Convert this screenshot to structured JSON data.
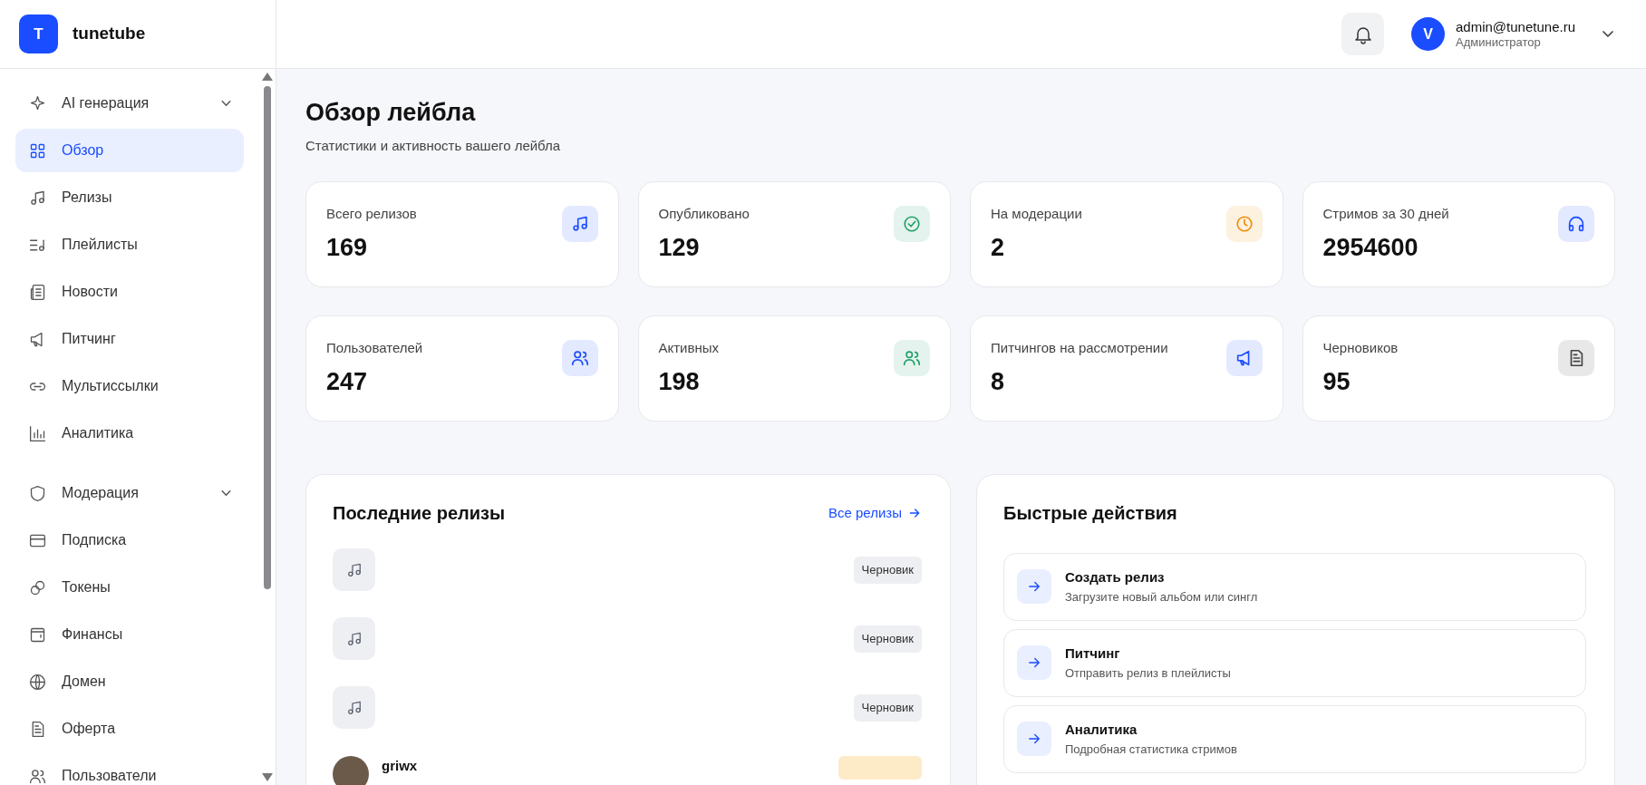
{
  "brand": {
    "logo_letter": "T",
    "name": "tunetube"
  },
  "user": {
    "avatar_letter": "V",
    "email": "admin@tunetune.ru",
    "role": "Администратор"
  },
  "sidebar": {
    "items": [
      {
        "label": "AI генерация",
        "kind": "group",
        "selected": false
      },
      {
        "label": "Обзор",
        "kind": "link",
        "selected": true
      },
      {
        "label": "Релизы",
        "kind": "link",
        "selected": false
      },
      {
        "label": "Плейлисты",
        "kind": "link",
        "selected": false
      },
      {
        "label": "Новости",
        "kind": "link",
        "selected": false
      },
      {
        "label": "Питчинг",
        "kind": "link",
        "selected": false
      },
      {
        "label": "Мультиссылки",
        "kind": "link",
        "selected": false
      },
      {
        "label": "Аналитика",
        "kind": "link",
        "selected": false
      },
      {
        "label": "Модерация",
        "kind": "group",
        "selected": false
      },
      {
        "label": "Подписка",
        "kind": "link",
        "selected": false
      },
      {
        "label": "Токены",
        "kind": "link",
        "selected": false
      },
      {
        "label": "Финансы",
        "kind": "link",
        "selected": false
      },
      {
        "label": "Домен",
        "kind": "link",
        "selected": false
      },
      {
        "label": "Оферта",
        "kind": "link",
        "selected": false
      },
      {
        "label": "Пользователи",
        "kind": "link",
        "selected": false
      }
    ]
  },
  "page": {
    "title": "Обзор лейбла",
    "subtitle": "Статистики и активность вашего лейбла"
  },
  "stats": [
    {
      "label": "Всего релизов",
      "value": "169",
      "color": "#1a4dff"
    },
    {
      "label": "Опубликовано",
      "value": "129",
      "color": "#22a06b"
    },
    {
      "label": "На модерации",
      "value": "2",
      "color": "#f08c00"
    },
    {
      "label": "Стримов за 30 дней",
      "value": "2954600",
      "color": "#1a4dff"
    },
    {
      "label": "Пользователей",
      "value": "247",
      "color": "#1a4dff"
    },
    {
      "label": "Активных",
      "value": "198",
      "color": "#22a06b"
    },
    {
      "label": "Питчингов на рассмотрении",
      "value": "8",
      "color": "#1a4dff"
    },
    {
      "label": "Черновиков",
      "value": "95",
      "color": "#444444"
    }
  ],
  "recent_releases": {
    "title": "Последние релизы",
    "link": "Все релизы",
    "rows": [
      {
        "kind": "placeholder",
        "status": "Черновик",
        "color": "#eeeff2"
      },
      {
        "kind": "placeholder",
        "status": "Черновик",
        "color": "#eeeff2"
      },
      {
        "kind": "placeholder",
        "status": "Черновик",
        "color": "#eeeff2"
      },
      {
        "kind": "photo",
        "title": "griwx",
        "color": "#fdebc8"
      }
    ]
  },
  "quick_actions": {
    "title": "Быстрые действия",
    "items": [
      {
        "title": "Создать релиз",
        "description": "Загрузите новый альбом или сингл"
      },
      {
        "title": "Питчинг",
        "description": "Отправить релиз в плейлисты"
      },
      {
        "title": "Аналитика",
        "description": "Подробная статистика стримов"
      }
    ]
  }
}
